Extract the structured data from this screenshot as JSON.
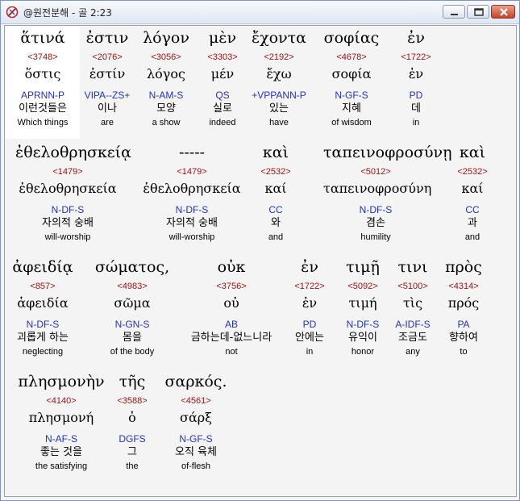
{
  "window": {
    "title": "@원전분해 - 골 2:23"
  },
  "rows": [
    [
      {
        "g": "ἅτινά",
        "n": "<3748>",
        "l": "ὅστις",
        "p": "APRNN-P",
        "k": "이런것들은",
        "e": "Which things"
      },
      {
        "g": "ἐστιν",
        "n": "<2076>",
        "l": "ἐστίν",
        "p": "VIPA--ZS+",
        "k": "이나",
        "e": "are"
      },
      {
        "g": "λόγον",
        "n": "<3056>",
        "l": "λόγος",
        "p": "N-AM-S",
        "k": "모양",
        "e": "a show"
      },
      {
        "g": "μὲν",
        "n": "<3303>",
        "l": "μέν",
        "p": "QS",
        "k": "실로",
        "e": "indeed"
      },
      {
        "g": "ἔχοντα",
        "n": "<2192>",
        "l": "ἔχω",
        "p": "+VPPANN-P",
        "k": "있는",
        "e": "have"
      },
      {
        "g": "σοφίας",
        "n": "<4678>",
        "l": "σοφία",
        "p": "N-GF-S",
        "k": "지혜",
        "e": "of wisdom"
      },
      {
        "g": "ἐν",
        "n": "<1722>",
        "l": "ἐν",
        "p": "PD",
        "k": "데",
        "e": "in"
      }
    ],
    [
      {
        "g": "ἐθελοθρησκείᾳ",
        "n": "<1479>",
        "l": "ἐθελοθρησκεία",
        "p": "N-DF-S",
        "k": "자의적 숭배",
        "e": "will-worship"
      },
      {
        "g": "-----",
        "n": "<1479>",
        "l": "ἐθελοθρησκεία",
        "p": "N-DF-S",
        "k": "자의적 숭배",
        "e": "will-worship"
      },
      {
        "g": "καὶ",
        "n": "<2532>",
        "l": "καί",
        "p": "CC",
        "k": "와",
        "e": "and"
      },
      {
        "g": "ταπεινοφροσύνῃ",
        "n": "<5012>",
        "l": "ταπεινοφροσύνη",
        "p": "N-DF-S",
        "k": "겸손",
        "e": "humility"
      },
      {
        "g": "καὶ",
        "n": "<2532>",
        "l": "καί",
        "p": "CC",
        "k": "과",
        "e": "and"
      }
    ],
    [
      {
        "g": "ἀφειδίᾳ",
        "n": "<857>",
        "l": "ἀφειδία",
        "p": "N-DF-S",
        "k": "괴롭게 하는",
        "e": "neglecting"
      },
      {
        "g": "σώματος,",
        "n": "<4983>",
        "l": "σῶμα",
        "p": "N-GN-S",
        "k": "몸을",
        "e": "of the body"
      },
      {
        "g": "οὐκ",
        "n": "<3756>",
        "l": "οὐ",
        "p": "AB",
        "k": "금하는데-없느니라",
        "e": "not"
      },
      {
        "g": "ἐν",
        "n": "<1722>",
        "l": "ἐν",
        "p": "PD",
        "k": "안에는",
        "e": "in"
      },
      {
        "g": "τιμῇ",
        "n": "<5092>",
        "l": "τιμή",
        "p": "N-DF-S",
        "k": "유익이",
        "e": "honor"
      },
      {
        "g": "τινι",
        "n": "<5100>",
        "l": "τὶς",
        "p": "A-IDF-S",
        "k": "조금도",
        "e": "any"
      },
      {
        "g": "πρὸς",
        "n": "<4314>",
        "l": "πρός",
        "p": "PA",
        "k": "향하여",
        "e": "to"
      }
    ],
    [
      {
        "g": "πλησμονὴν",
        "n": "<4140>",
        "l": "πλησμονή",
        "p": "N-AF-S",
        "k": "좋는 것을",
        "e": "the satisfying"
      },
      {
        "g": "τῆς",
        "n": "<3588>",
        "l": "ὁ",
        "p": "DGFS",
        "k": "그",
        "e": "the"
      },
      {
        "g": "σαρκός.",
        "n": "<4561>",
        "l": "σάρξ",
        "p": "N-GF-S",
        "k": "오직 육체",
        "e": "of-flesh"
      }
    ]
  ]
}
